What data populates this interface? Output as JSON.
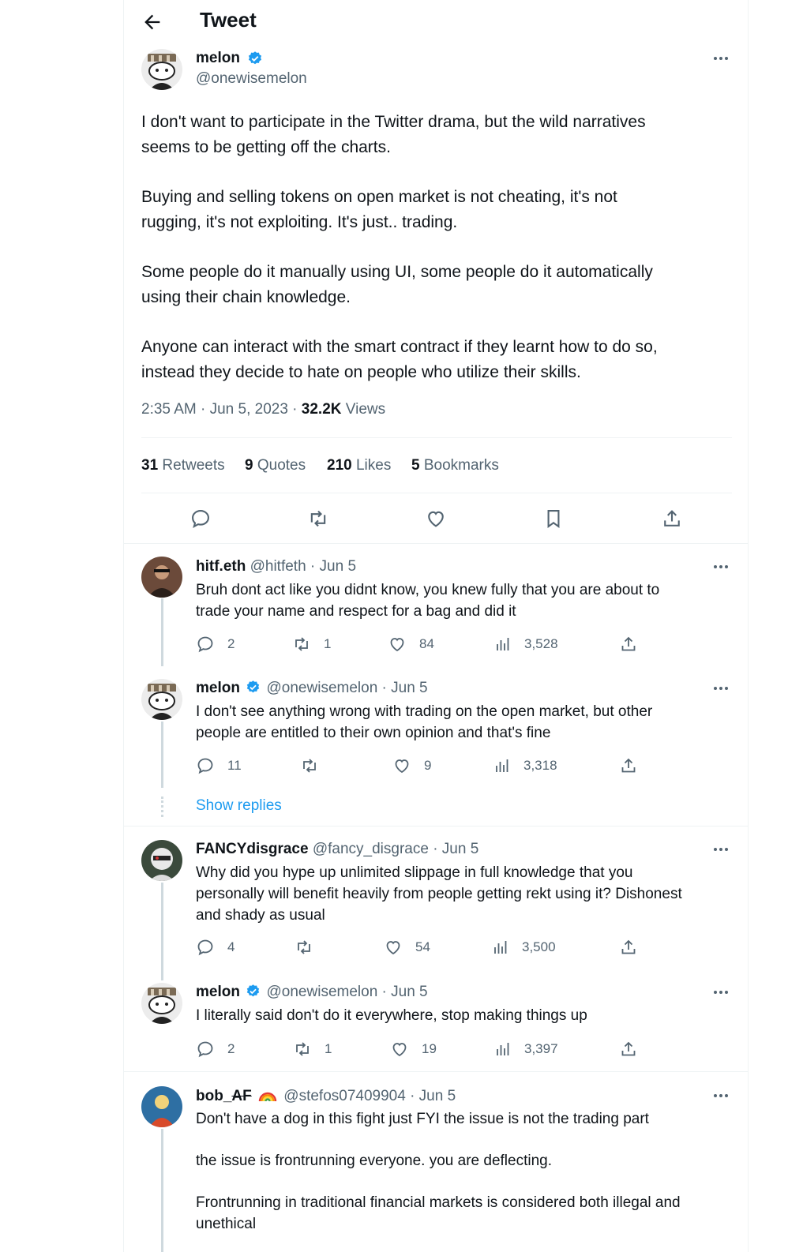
{
  "header": {
    "title": "Tweet"
  },
  "main_tweet": {
    "name": "melon",
    "handle": "@onewisemelon",
    "paragraphs": [
      "I don't want to participate in the Twitter drama, but the wild narratives",
      "seems to be getting off the charts.",
      "Buying and selling tokens on open market is not cheating, it's not",
      "rugging, it's not exploiting. It's just.. trading.",
      "Some people do it manually using UI, some people do it automatically",
      "using their chain knowledge.",
      "Anyone can interact with the smart contract if they learnt how to do so,",
      "instead they decide to hate on people who utilize their skills."
    ],
    "timestamp": "2:35 AM · Jun 5, 2023 · ",
    "views_count": "32.2K",
    "views_label": " Views",
    "stats": {
      "retweets_count": "31",
      "retweets_label": " Retweets",
      "quotes_count": "9",
      "quotes_label": " Quotes",
      "likes_count": "210",
      "likes_label": " Likes",
      "bookmarks_count": "5",
      "bookmarks_label": " Bookmarks"
    }
  },
  "replies": [
    {
      "name": "hitf.eth",
      "meta": "@hitfeth · Jun 5",
      "lines": [
        "Bruh dont act like you didnt know, you knew fully  that you are about to",
        "trade your name and respect for a bag and did it"
      ],
      "reply_count": "2",
      "retweet_count": "1",
      "like_count": "84",
      "view_count": "3,528"
    },
    {
      "name": "melon",
      "meta": "@onewisemelon · Jun 5",
      "lines": [
        "I don't see anything wrong with trading on the open market, but other",
        "people are entitled to their own opinion and that's fine"
      ],
      "reply_count": "11",
      "retweet_count": "",
      "like_count": "9",
      "view_count": "3,318"
    },
    {
      "name": "FANCYdisgrace",
      "meta": "@fancy_disgrace · Jun 5",
      "lines": [
        "Why did you hype up unlimited slippage in full knowledge that you",
        "personally will benefit heavily from people getting rekt using it? Dishonest",
        "and shady as usual"
      ],
      "reply_count": "4",
      "retweet_count": "",
      "like_count": "54",
      "view_count": "3,500"
    },
    {
      "name": "melon",
      "meta": "@onewisemelon · Jun 5",
      "lines": [
        "I literally said don't do it everywhere, stop making things up"
      ],
      "reply_count": "2",
      "retweet_count": "1",
      "like_count": "19",
      "view_count": "3,397"
    },
    {
      "name": "bob_",
      "name_strike": "AF",
      "meta": "@stefos07409904 · Jun 5",
      "lines": [
        "Don't have a dog in this fight just FYI the issue is not the trading part",
        "the issue is frontrunning everyone. you are deflecting.",
        "Frontrunning in traditional financial markets is considered both illegal and",
        "unethical"
      ]
    }
  ],
  "show_replies": "Show replies",
  "colors": {
    "verified": "#1d9bf0",
    "muted": "#536471",
    "border": "#eff3f4",
    "thread": "#cfd9de"
  }
}
